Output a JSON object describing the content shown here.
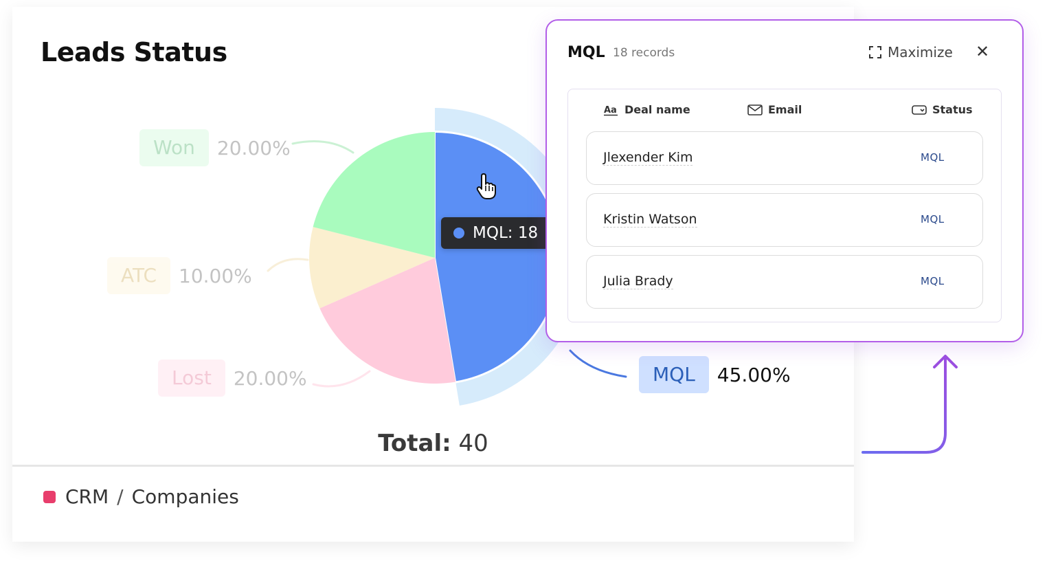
{
  "card": {
    "title": "Leads Status",
    "total_label": "Total:",
    "total_value": "40",
    "breadcrumb": {
      "first": "CRM",
      "separator": "/",
      "second": "Companies"
    }
  },
  "chart_data": {
    "type": "pie",
    "title": "Leads Status",
    "total": 40,
    "slices": [
      {
        "name": "MQL",
        "value": 18,
        "percent": "45.00%",
        "color": "#5b8ff5",
        "label_bg": "#cfe0ff",
        "label_color": "#2b5fb8",
        "highlighted": true
      },
      {
        "name": "Lost",
        "value": 8,
        "percent": "20.00%",
        "color": "#ffcbdc",
        "label_bg": "#ffd7e4",
        "label_color": "#e26b8e",
        "highlighted": false
      },
      {
        "name": "ATC",
        "value": 4,
        "percent": "10.00%",
        "color": "#fbefcf",
        "label_bg": "#fdf1d4",
        "label_color": "#c9a54a",
        "highlighted": false
      },
      {
        "name": "Won",
        "value": 8,
        "percent": "20.00%",
        "color": "#a9fbbe",
        "label_bg": "#c8f7d3",
        "label_color": "#3eaa5d",
        "highlighted": false
      }
    ],
    "highlight_ring_color": "#d6ebfb"
  },
  "tooltip": {
    "text": "MQL: 18",
    "dot_color": "#5b8ff5"
  },
  "panel": {
    "title": "MQL",
    "count": "18 records",
    "maximize_label": "Maximize",
    "close_glyph": "✕",
    "columns": {
      "deal_name": "Deal name",
      "email": "Email",
      "status": "Status"
    },
    "rows": [
      {
        "name": "Jlexender Kim",
        "status": "MQL"
      },
      {
        "name": "Kristin Watson",
        "status": "MQL"
      },
      {
        "name": "Julia Brady",
        "status": "MQL"
      }
    ],
    "border_color": "#b25ee8"
  },
  "icons": {
    "cursor": "hand-pointer-icon",
    "maximize": "expand-icon",
    "close": "close-icon",
    "deal_name": "text-aa-icon",
    "email": "envelope-icon",
    "status": "status-toggle-icon",
    "arrow": "arrow-up-icon"
  }
}
